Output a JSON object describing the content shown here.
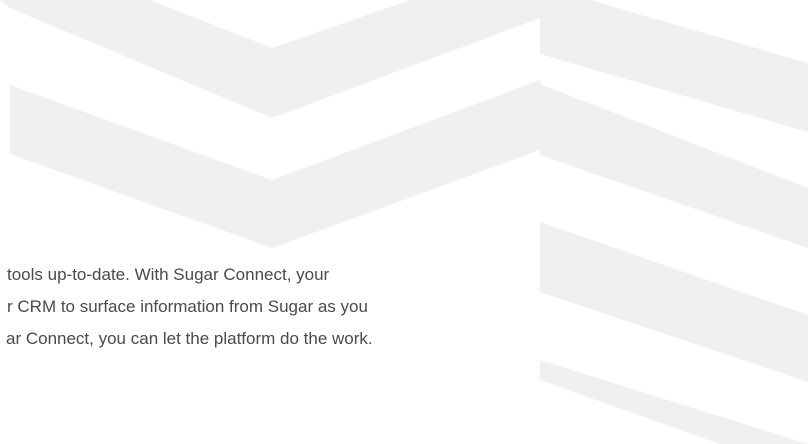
{
  "content": {
    "paragraph_lines": [
      "tools up-to-date. With Sugar Connect, your",
      "r CRM to surface information from Sugar as you",
      "ar Connect, you can let the platform do the work."
    ]
  },
  "colors": {
    "background": "#ffffff",
    "pattern": "#f0f0f0",
    "text": "#4a4a4a"
  }
}
